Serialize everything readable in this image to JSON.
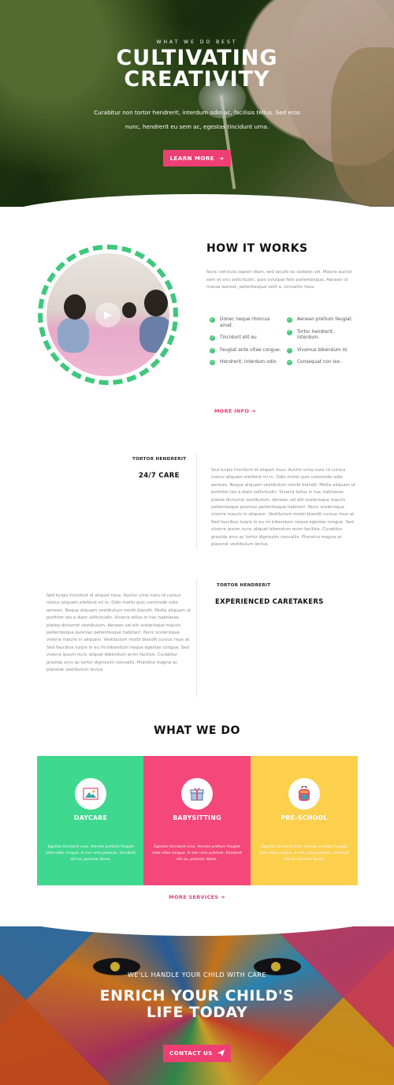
{
  "hero": {
    "kicker": "WHAT WE DO BEST",
    "title_line1": "CULTIVATING",
    "title_line2": "CREATIVITY",
    "text": "Curabitur non tortor hendrerit, interdum odio ac, facilisis tellus. Sed eros nunc, hendrerit eu sem ac, egestas tincidunt urna.",
    "button_label": "LEARN MORE",
    "button_icon": "arrow-right-icon"
  },
  "how": {
    "title": "HOW IT WORKS",
    "text": "Nunc vehicula sapien diam, sed iaculis ex sodales vel. Mauris auctor sem et orci sollicitudin, quis volutpat felis pellentesque. Aenean id massa laoreet, pellentesque velit a, convallis risus.",
    "checks_left": [
      "Donec neque rhoncus amet.",
      "Tincidunt elit eu",
      "Feugiat ante vitae congue.",
      "Hendrerit, interdum odio"
    ],
    "checks_right": [
      "Aenean pretium feugiat.",
      "Tortor hendrerit, interdum.",
      "Vivamus bibendum id.",
      "Consequat non leo."
    ],
    "more_label": "MORE INFO ➔"
  },
  "feature1": {
    "kicker": "TORTOR HENDRERIT",
    "heading": "24/7 CARE",
    "text": "Sed turpis tincidunt id aliquet risus. Auctor urna nunc id cursus metus aliquam eleifend mi in. Odio morbi quis commodo odio aenean. Neque aliquam vestibulum morbi blandit. Mollis aliquam ut porttitor leo a diam sollicitudin. Viverra tellus in hac habitasse platea dictumst vestibulum. Aenean vel elit scelerisque mauris pellentesque pulvinar pellentesque habitant. Nunc scelerisque viverra mauris in aliquam. Vestibulum morbi blandit cursus risus at. Sed faucibus turpis in eu mi bibendum neque egestas congue. Sed viverra ipsum nunc aliquet bibendum enim facilisis. Curabitur gravida arcu ac tortor dignissim convallis. Pharetra magna ac placerat vestibulum lectus"
  },
  "feature2": {
    "kicker": "TORTOR HENDRERIT",
    "heading": "EXPERIENCED CARETAKERS",
    "text": "Sed turpis tincidunt id aliquet risus. Auctor urna nunc id cursus metus aliquam eleifend mi in. Odio morbi quis commodo odio aenean. Neque aliquam vestibulum morbi blandit. Mollis aliquam ut porttitor leo a diam sollicitudin. Viverra tellus in hac habitasse platea dictumst vestibulum. Aenean vel elit scelerisque mauris pellentesque pulvinar pellentesque habitant. Nunc scelerisque viverra mauris in aliquam. Vestibulum morbi blandit cursus risus at. Sed faucibus turpis in eu mi bibendum neque egestas congue. Sed viverra ipsum nunc aliquet bibendum enim facilisis. Curabitur gravida arcu ac tortor dignissim convallis. Pharetra magna ac placerat vestibulum lectus"
  },
  "what_we_do": {
    "title": "WHAT WE DO",
    "cards": [
      {
        "title": "DAYCARE",
        "icon": "mountain-picture-icon",
        "color": "#3ed88e",
        "text": "Egestas tincidunt urna. Aenean pretium feugiat ante vitae congue. In nec urna pulvinar, tincidunt elit eu, pulvinar libero."
      },
      {
        "title": "BABYSITTING",
        "icon": "gift-box-icon",
        "color": "#f4477a",
        "text": "Egestas tincidunt urna. Aenean pretium feugiat ante vitae congue. In nec urna pulvinar, tincidunt elit eu, pulvinar libero."
      },
      {
        "title": "PRE-SCHOOL",
        "icon": "backpack-icon",
        "color": "#fccf4d",
        "text": "Egestas tincidunt urna. Aenean pretium feugiat ante vitae congue. In nec urna pulvinar, tincidunt elit eu, pulvinar libero."
      }
    ],
    "more_label": "MORE SERVICES ➔"
  },
  "cta": {
    "kicker": "WE'LL HANDLE YOUR CHILD WITH CARE",
    "title_line1": "ENRICH YOUR CHILD'S",
    "title_line2": "LIFE TODAY",
    "button_label": "CONTACT US",
    "button_icon": "paper-plane-icon"
  },
  "colors": {
    "accent": "#ee3f74",
    "check": "#4ec77e"
  }
}
